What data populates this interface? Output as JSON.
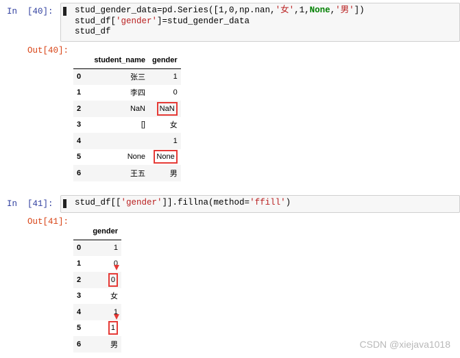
{
  "cell40": {
    "in_prompt": "In  [40]:",
    "out_prompt": "Out[40]:",
    "code": {
      "line1_a": "stud_gender_data=pd.Series([1,0,np.nan,",
      "line1_s1": "'女'",
      "line1_b": ",1,",
      "line1_kw": "None",
      "line1_c": ",",
      "line1_s2": "'男'",
      "line1_d": "])",
      "line2_a": "stud_df[",
      "line2_s": "'gender'",
      "line2_b": "]=stud_gender_data",
      "line3": "stud_df"
    },
    "table": {
      "headers": [
        "",
        "student_name",
        "gender"
      ],
      "rows": [
        {
          "index": "0",
          "student_name": "张三",
          "gender": "1"
        },
        {
          "index": "1",
          "student_name": "李四",
          "gender": "0"
        },
        {
          "index": "2",
          "student_name": "NaN",
          "gender": "NaN"
        },
        {
          "index": "3",
          "student_name": "[]",
          "gender": "女"
        },
        {
          "index": "4",
          "student_name": "",
          "gender": "1"
        },
        {
          "index": "5",
          "student_name": "None",
          "gender": "None"
        },
        {
          "index": "6",
          "student_name": "王五",
          "gender": "男"
        }
      ]
    }
  },
  "cell41": {
    "in_prompt": "In  [41]:",
    "out_prompt": "Out[41]:",
    "code": {
      "a": "stud_df[[",
      "s1": "'gender'",
      "b": "]].fillna(method=",
      "s2": "'ffill'",
      "c": ")"
    },
    "table": {
      "headers": [
        "",
        "gender"
      ],
      "rows": [
        {
          "index": "0",
          "gender": "1"
        },
        {
          "index": "1",
          "gender": "0"
        },
        {
          "index": "2",
          "gender": "0"
        },
        {
          "index": "3",
          "gender": "女"
        },
        {
          "index": "4",
          "gender": "1"
        },
        {
          "index": "5",
          "gender": "1"
        },
        {
          "index": "6",
          "gender": "男"
        }
      ]
    }
  },
  "watermark": "CSDN @xiejava1018",
  "colors": {
    "highlight": "#e53935",
    "prompt_in": "#303f9f",
    "prompt_out": "#d84315"
  }
}
